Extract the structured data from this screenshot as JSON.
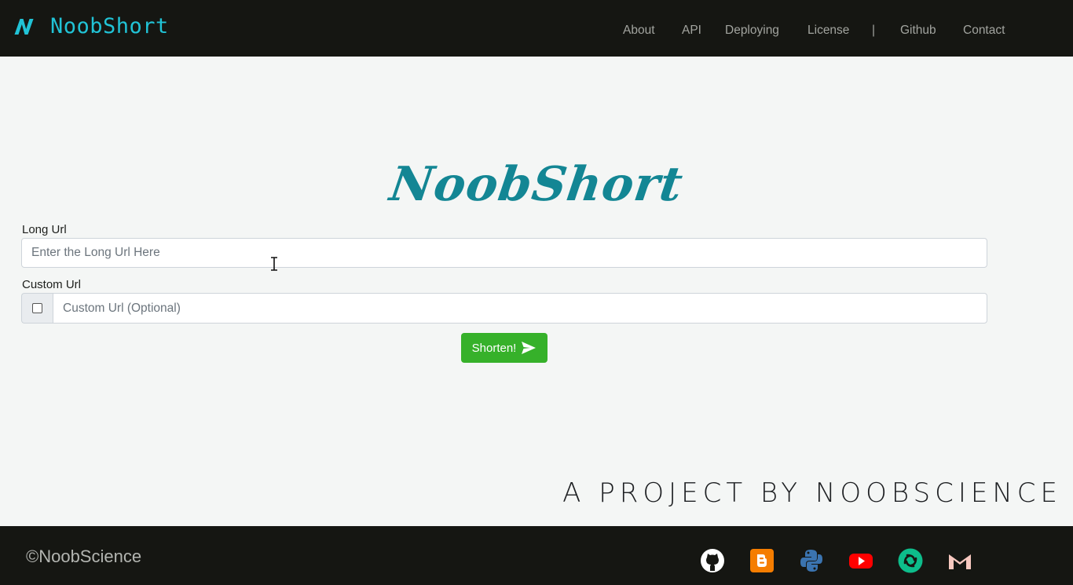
{
  "brand": {
    "name": "NoobShort",
    "logo_icon": "noobshort-n-logo",
    "accent": "#21c3d6"
  },
  "nav": {
    "items": [
      {
        "label": "About"
      },
      {
        "label": "API"
      },
      {
        "label": "Deploying"
      },
      {
        "label": "License"
      },
      {
        "label": "|"
      },
      {
        "label": "Github"
      },
      {
        "label": "Contact"
      }
    ]
  },
  "hero": {
    "title": "NoobShort",
    "color": "#138694"
  },
  "form": {
    "long_url": {
      "label": "Long Url",
      "placeholder": "Enter the Long Url Here",
      "value": ""
    },
    "custom_url": {
      "label": "Custom Url",
      "placeholder": "Custom Url (Optional)",
      "value": "",
      "checked": false
    },
    "submit": {
      "label": "Shorten!",
      "icon": "paper-plane-icon",
      "color": "#36b12a"
    }
  },
  "tagline": "A PROJECT BY NOOBSCIENCE",
  "footer": {
    "copyright": "©NoobScience",
    "social": [
      {
        "name": "github-icon"
      },
      {
        "name": "blogger-icon"
      },
      {
        "name": "python-icon"
      },
      {
        "name": "youtube-icon"
      },
      {
        "name": "element-icon"
      },
      {
        "name": "gmail-icon"
      }
    ]
  }
}
